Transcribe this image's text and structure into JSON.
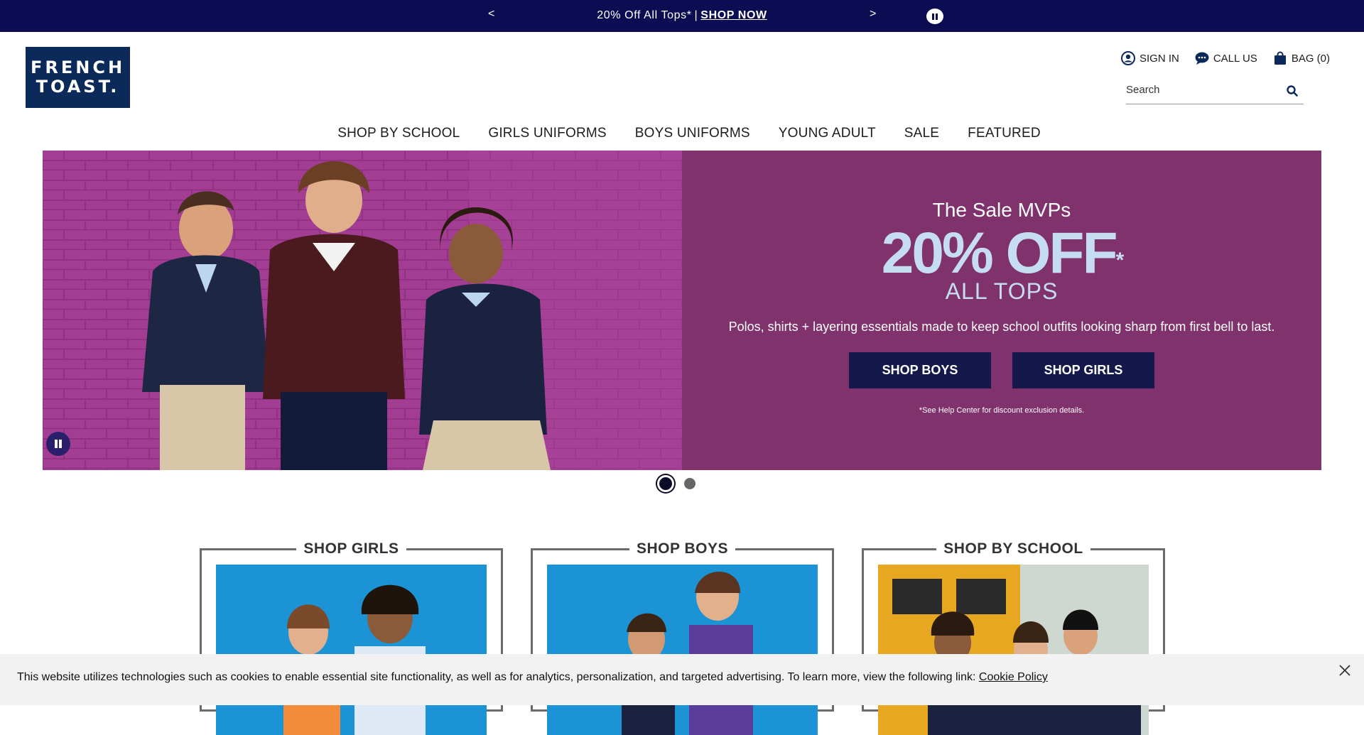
{
  "promo_bar": {
    "prev": "<",
    "next": ">",
    "message": "20% Off All Tops*",
    "separator": "|",
    "cta": "SHOP NOW"
  },
  "logo": {
    "line1": "FRENCH",
    "line2": "TOAST."
  },
  "utility": {
    "sign_in": "SIGN IN",
    "call_us": "CALL US",
    "bag": "BAG (0)"
  },
  "search": {
    "placeholder": "Search"
  },
  "nav": {
    "items": [
      "SHOP BY SCHOOL",
      "GIRLS UNIFORMS",
      "BOYS UNIFORMS",
      "YOUNG ADULT",
      "SALE",
      "FEATURED"
    ]
  },
  "hero": {
    "kicker": "The Sale MVPs",
    "headline": "20% OFF",
    "headline_mark": "*",
    "subhead": "ALL TOPS",
    "description": "Polos, shirts + layering essentials made to keep school outfits looking sharp from first bell to last.",
    "btn_boys": "SHOP BOYS",
    "btn_girls": "SHOP GIRLS",
    "fine_print": "*See Help Center for discount exclusion details.",
    "slides_total": 2,
    "active_slide": 1
  },
  "tiles": [
    {
      "label": "SHOP GIRLS"
    },
    {
      "label": "SHOP BOYS"
    },
    {
      "label": "SHOP BY SCHOOL"
    }
  ],
  "cookie": {
    "text": "This website utilizes technologies such as cookies to enable essential site functionality, as well as for analytics, personalization, and targeted advertising. To learn more, view the following link: ",
    "link": "Cookie Policy"
  },
  "colors": {
    "promo_bg": "#0c0c52",
    "logo_bg": "#0c2a59",
    "hero_bg": "#80326c",
    "hero_accent": "#c6dcf1",
    "button_bg": "#15184b"
  }
}
